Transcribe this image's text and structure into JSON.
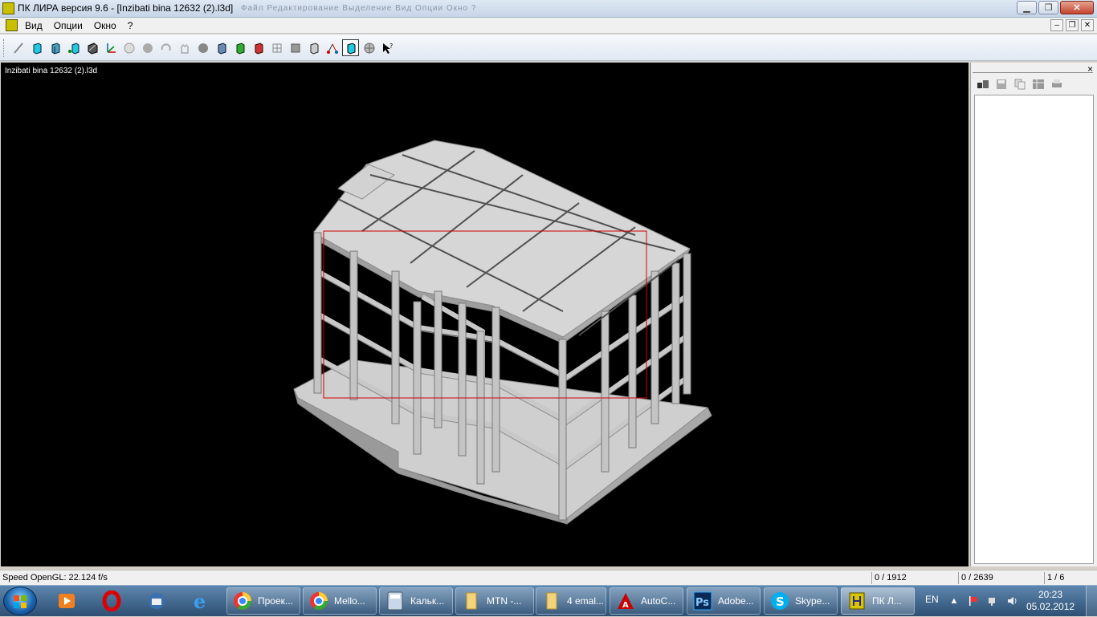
{
  "window": {
    "title": "ПК ЛИРА  версия 9.6 - [Inzibati bina 12632 (2).l3d]",
    "faded_menu_text": "Файл    Редактирование    Выделение    Вид    Опции    Окно    ?"
  },
  "menubar": {
    "items": [
      "Вид",
      "Опции",
      "Окно",
      "?"
    ]
  },
  "toolbar": {
    "tools": [
      "pencil-icon",
      "cube-cyan-icon",
      "cube-frame-icon",
      "node-cube-icon",
      "hatch-cube-icon",
      "axes-icon",
      "sphere-light-icon",
      "sphere-gray-icon",
      "rotate-icon",
      "hand-icon",
      "sphere-dark-icon",
      "cube-blue-icon",
      "cube-green-icon",
      "cube-red-icon",
      "grid-cube-icon",
      "grid-cube2-icon",
      "cube-outline-icon",
      "node-network-icon",
      "cube-selected-icon",
      "globe-icon",
      "help-cursor-icon"
    ],
    "active_index": 18
  },
  "viewport": {
    "doc_label": "Inzibati bina 12632 (2).l3d"
  },
  "sidepanel": {
    "close_label": "×",
    "tools": [
      "objects-icon",
      "save-icon",
      "copy-icon",
      "table-icon",
      "print-icon"
    ]
  },
  "statusbar": {
    "speed": "Speed OpenGL: 22.124 f/s",
    "nodes": "0 / 1912",
    "elements": "0 / 2639",
    "page": "1 / 6"
  },
  "taskbar": {
    "buttons": [
      {
        "label": "Проек...",
        "icon": "chrome-icon"
      },
      {
        "label": "Mello...",
        "icon": "chrome-icon"
      },
      {
        "label": "Кальк...",
        "icon": "calculator-icon"
      },
      {
        "label": "MTN -...",
        "icon": "folder-icon"
      },
      {
        "label": "4 emal...",
        "icon": "folder-icon"
      },
      {
        "label": "AutoC...",
        "icon": "autocad-icon"
      },
      {
        "label": "Adobe...",
        "icon": "photoshop-icon"
      },
      {
        "label": "Skype...",
        "icon": "skype-icon"
      },
      {
        "label": "ПК Л...",
        "icon": "lira-icon"
      }
    ],
    "language": "EN",
    "time": "20:23",
    "date": "05.02.2012"
  }
}
